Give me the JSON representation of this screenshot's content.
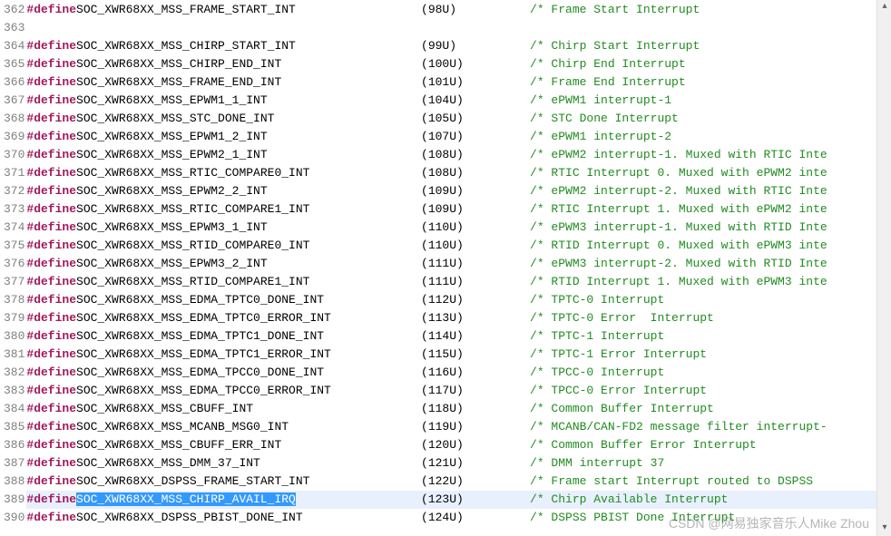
{
  "watermark": "CSDN @网易独家音乐人Mike Zhou",
  "scrollbar": {
    "up_glyph": "▴",
    "down_glyph": "▾"
  },
  "lines": [
    {
      "num": 362,
      "kw": "#define",
      "name": "SOC_XWR68XX_MSS_FRAME_START_INT",
      "val": "(98U)",
      "cmt": "/* Frame Start Interrupt"
    },
    {
      "num": 363,
      "blank": true
    },
    {
      "num": 364,
      "kw": "#define",
      "name": "SOC_XWR68XX_MSS_CHIRP_START_INT",
      "val": "(99U)",
      "cmt": "/* Chirp Start Interrupt"
    },
    {
      "num": 365,
      "kw": "#define",
      "name": "SOC_XWR68XX_MSS_CHIRP_END_INT",
      "val": "(100U)",
      "cmt": "/* Chirp End Interrupt"
    },
    {
      "num": 366,
      "kw": "#define",
      "name": "SOC_XWR68XX_MSS_FRAME_END_INT",
      "val": "(101U)",
      "cmt": "/* Frame End Interrupt"
    },
    {
      "num": 367,
      "kw": "#define",
      "name": "SOC_XWR68XX_MSS_EPWM1_1_INT",
      "val": "(104U)",
      "cmt": "/* ePWM1 interrupt-1"
    },
    {
      "num": 368,
      "kw": "#define",
      "name": "SOC_XWR68XX_MSS_STC_DONE_INT",
      "val": "(105U)",
      "cmt": "/* STC Done Interrupt"
    },
    {
      "num": 369,
      "kw": "#define",
      "name": "SOC_XWR68XX_MSS_EPWM1_2_INT",
      "val": "(107U)",
      "cmt": "/* ePWM1 interrupt-2"
    },
    {
      "num": 370,
      "kw": "#define",
      "name": "SOC_XWR68XX_MSS_EPWM2_1_INT",
      "val": "(108U)",
      "cmt": "/* ePWM2 interrupt-1. Muxed with RTIC Inte"
    },
    {
      "num": 371,
      "kw": "#define",
      "name": "SOC_XWR68XX_MSS_RTIC_COMPARE0_INT",
      "val": "(108U)",
      "cmt": "/* RTIC Interrupt 0. Muxed with ePWM2 inte"
    },
    {
      "num": 372,
      "kw": "#define",
      "name": "SOC_XWR68XX_MSS_EPWM2_2_INT",
      "val": "(109U)",
      "cmt": "/* ePWM2 interrupt-2. Muxed with RTIC Inte"
    },
    {
      "num": 373,
      "kw": "#define",
      "name": "SOC_XWR68XX_MSS_RTIC_COMPARE1_INT",
      "val": "(109U)",
      "cmt": "/* RTIC Interrupt 1. Muxed with ePWM2 inte"
    },
    {
      "num": 374,
      "kw": "#define",
      "name": "SOC_XWR68XX_MSS_EPWM3_1_INT",
      "val": "(110U)",
      "cmt": "/* ePWM3 interrupt-1. Muxed with RTID Inte"
    },
    {
      "num": 375,
      "kw": "#define",
      "name": "SOC_XWR68XX_MSS_RTID_COMPARE0_INT",
      "val": "(110U)",
      "cmt": "/* RTID Interrupt 0. Muxed with ePWM3 inte"
    },
    {
      "num": 376,
      "kw": "#define",
      "name": "SOC_XWR68XX_MSS_EPWM3_2_INT",
      "val": "(111U)",
      "cmt": "/* ePWM3 interrupt-2. Muxed with RTID Inte"
    },
    {
      "num": 377,
      "kw": "#define",
      "name": "SOC_XWR68XX_MSS_RTID_COMPARE1_INT",
      "val": "(111U)",
      "cmt": "/* RTID Interrupt 1. Muxed with ePWM3 inte"
    },
    {
      "num": 378,
      "kw": "#define",
      "name": "SOC_XWR68XX_MSS_EDMA_TPTC0_DONE_INT",
      "val": "(112U)",
      "cmt": "/* TPTC-0 Interrupt"
    },
    {
      "num": 379,
      "kw": "#define",
      "name": "SOC_XWR68XX_MSS_EDMA_TPTC0_ERROR_INT",
      "val": "(113U)",
      "cmt": "/* TPTC-0 Error  Interrupt"
    },
    {
      "num": 380,
      "kw": "#define",
      "name": "SOC_XWR68XX_MSS_EDMA_TPTC1_DONE_INT",
      "val": "(114U)",
      "cmt": "/* TPTC-1 Interrupt"
    },
    {
      "num": 381,
      "kw": "#define",
      "name": "SOC_XWR68XX_MSS_EDMA_TPTC1_ERROR_INT",
      "val": "(115U)",
      "cmt": "/* TPTC-1 Error Interrupt"
    },
    {
      "num": 382,
      "kw": "#define",
      "name": "SOC_XWR68XX_MSS_EDMA_TPCC0_DONE_INT",
      "val": "(116U)",
      "cmt": "/* TPCC-0 Interrupt"
    },
    {
      "num": 383,
      "kw": "#define",
      "name": "SOC_XWR68XX_MSS_EDMA_TPCC0_ERROR_INT",
      "val": "(117U)",
      "cmt": "/* TPCC-0 Error Interrupt"
    },
    {
      "num": 384,
      "kw": "#define",
      "name": "SOC_XWR68XX_MSS_CBUFF_INT",
      "val": "(118U)",
      "cmt": "/* Common Buffer Interrupt"
    },
    {
      "num": 385,
      "kw": "#define",
      "name": "SOC_XWR68XX_MSS_MCANB_MSG0_INT",
      "val": "(119U)",
      "cmt": "/* MCANB/CAN-FD2 message filter interrupt-"
    },
    {
      "num": 386,
      "kw": "#define",
      "name": "SOC_XWR68XX_MSS_CBUFF_ERR_INT",
      "val": "(120U)",
      "cmt": "/* Common Buffer Error Interrupt"
    },
    {
      "num": 387,
      "kw": "#define",
      "name": "SOC_XWR68XX_MSS_DMM_37_INT",
      "val": "(121U)",
      "cmt": "/* DMM interrupt 37"
    },
    {
      "num": 388,
      "kw": "#define",
      "name": "SOC_XWR68XX_DSPSS_FRAME_START_INT",
      "val": "(122U)",
      "cmt": "/* Frame start Interrupt routed to DSPSS"
    },
    {
      "num": 389,
      "kw": "#define",
      "name": "SOC_XWR68XX_MSS_CHIRP_AVAIL_IRQ",
      "val": "(123U)",
      "cmt": "/* Chirp Available Interrupt",
      "selected": true
    },
    {
      "num": 390,
      "kw": "#define",
      "name": "SOC_XWR68XX_DSPSS_PBIST_DONE_INT",
      "val": "(124U)",
      "cmt": "/* DSPSS PBIST Done Interrupt"
    }
  ]
}
